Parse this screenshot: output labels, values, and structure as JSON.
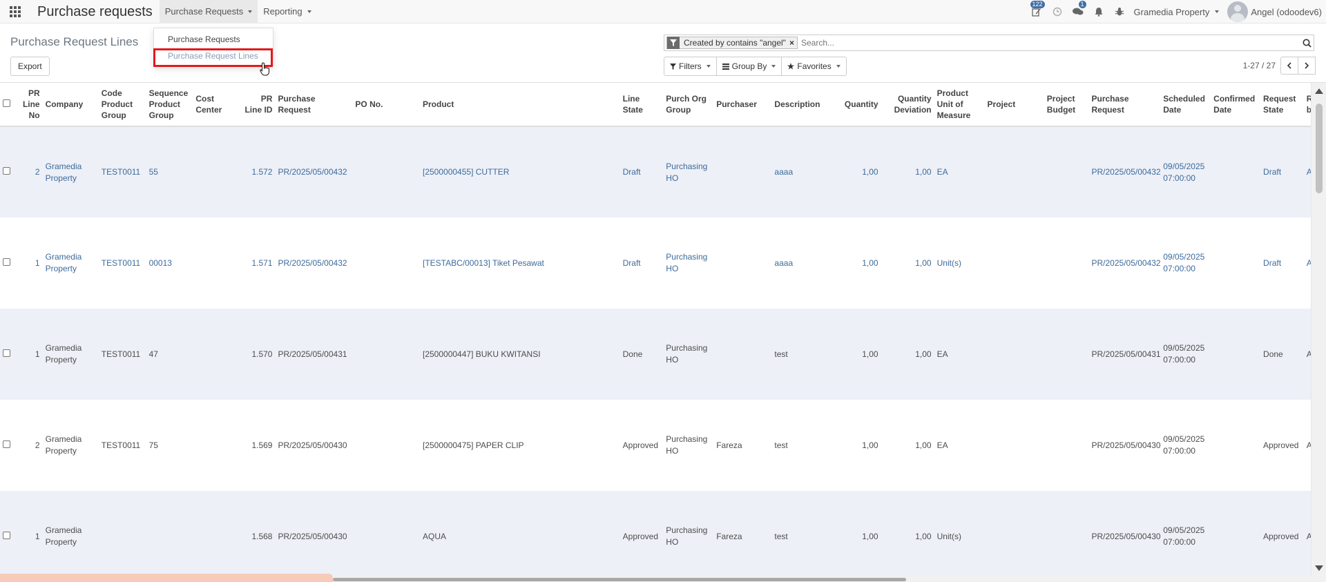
{
  "navbar": {
    "app_title": "Purchase requests",
    "menu": [
      {
        "label": "Purchase Requests"
      },
      {
        "label": "Reporting"
      }
    ],
    "activity_badge": "122",
    "messages_badge": "1",
    "company": "Gramedia Property",
    "user": "Angel (odoodev6)"
  },
  "dropdown": {
    "items": [
      "Purchase Requests",
      "Purchase Request Lines"
    ]
  },
  "control_panel": {
    "breadcrumb": "Purchase Request Lines",
    "export_label": "Export",
    "facet": "Created by contains \"angel\"",
    "search_placeholder": "Search...",
    "filters_label": "Filters",
    "group_by_label": "Group By",
    "favorites_label": "Favorites",
    "pager": "1-27 / 27"
  },
  "table": {
    "headers": [
      "PR Line No",
      "Company",
      "Code Product Group",
      "Sequence Product Group",
      "Cost Center",
      "PR Line ID",
      "Purchase Request",
      "PO No.",
      "Product",
      "Line State",
      "Purch Org Group",
      "Purchaser",
      "Description",
      "Quantity",
      "Quantity Deviation",
      "Product Unit of Measure",
      "Project",
      "Project Budget",
      "Purchase Request",
      "Scheduled Date",
      "Confirmed Date",
      "Request State",
      "Requested by"
    ],
    "rows": [
      {
        "line_no": "2",
        "company": "Gramedia Property",
        "code_group": "TEST0011",
        "seq_group": "55",
        "cost_center": "",
        "line_id": "1.572",
        "purchase_request": "PR/2025/05/00432",
        "po_no": "",
        "product": "[2500000455] CUTTER",
        "line_state": "Draft",
        "org_group": "Purchasing HO",
        "purchaser": "",
        "description": "aaaa",
        "quantity": "1,00",
        "qty_dev": "1,00",
        "uom": "EA",
        "project": "",
        "project_budget": "",
        "purchase_request2": "PR/2025/05/00432",
        "scheduled_date": "09/05/2025 07:00:00",
        "confirmed_date": "",
        "request_state": "Draft",
        "requested_by": "Angel"
      },
      {
        "line_no": "1",
        "company": "Gramedia Property",
        "code_group": "TEST0011",
        "seq_group": "00013",
        "cost_center": "",
        "line_id": "1.571",
        "purchase_request": "PR/2025/05/00432",
        "po_no": "",
        "product": "[TESTABC/00013] Tiket Pesawat",
        "line_state": "Draft",
        "org_group": "Purchasing HO",
        "purchaser": "",
        "description": "aaaa",
        "quantity": "1,00",
        "qty_dev": "1,00",
        "uom": "Unit(s)",
        "project": "",
        "project_budget": "",
        "purchase_request2": "PR/2025/05/00432",
        "scheduled_date": "09/05/2025 07:00:00",
        "confirmed_date": "",
        "request_state": "Draft",
        "requested_by": "Angel"
      },
      {
        "line_no": "1",
        "company": "Gramedia Property",
        "code_group": "TEST0011",
        "seq_group": "47",
        "cost_center": "",
        "line_id": "1.570",
        "purchase_request": "PR/2025/05/00431",
        "po_no": "",
        "product": "[2500000447] BUKU KWITANSI",
        "line_state": "Done",
        "org_group": "Purchasing HO",
        "purchaser": "",
        "description": "test",
        "quantity": "1,00",
        "qty_dev": "1,00",
        "uom": "EA",
        "project": "",
        "project_budget": "",
        "purchase_request2": "PR/2025/05/00431",
        "scheduled_date": "09/05/2025 07:00:00",
        "confirmed_date": "",
        "request_state": "Done",
        "requested_by": "Angel"
      },
      {
        "line_no": "2",
        "company": "Gramedia Property",
        "code_group": "TEST0011",
        "seq_group": "75",
        "cost_center": "",
        "line_id": "1.569",
        "purchase_request": "PR/2025/05/00430",
        "po_no": "",
        "product": "[2500000475] PAPER CLIP",
        "line_state": "Approved",
        "org_group": "Purchasing HO",
        "purchaser": "Fareza",
        "description": "test",
        "quantity": "1,00",
        "qty_dev": "1,00",
        "uom": "EA",
        "project": "",
        "project_budget": "",
        "purchase_request2": "PR/2025/05/00430",
        "scheduled_date": "09/05/2025 07:00:00",
        "confirmed_date": "",
        "request_state": "Approved",
        "requested_by": "Angel"
      },
      {
        "line_no": "1",
        "company": "Gramedia Property",
        "code_group": "",
        "seq_group": "",
        "cost_center": "",
        "line_id": "1.568",
        "purchase_request": "PR/2025/05/00430",
        "po_no": "",
        "product": "AQUA",
        "line_state": "Approved",
        "org_group": "Purchasing HO",
        "purchaser": "Fareza",
        "description": "test",
        "quantity": "1,00",
        "qty_dev": "1,00",
        "uom": "Unit(s)",
        "project": "",
        "project_budget": "",
        "purchase_request2": "PR/2025/05/00430",
        "scheduled_date": "09/05/2025 07:00:00",
        "confirmed_date": "",
        "request_state": "Approved",
        "requested_by": "Angel"
      }
    ]
  },
  "colors": {
    "link": "#3d6a9b",
    "row_odd": "#edf0f7",
    "highlight": "#e3191b"
  }
}
